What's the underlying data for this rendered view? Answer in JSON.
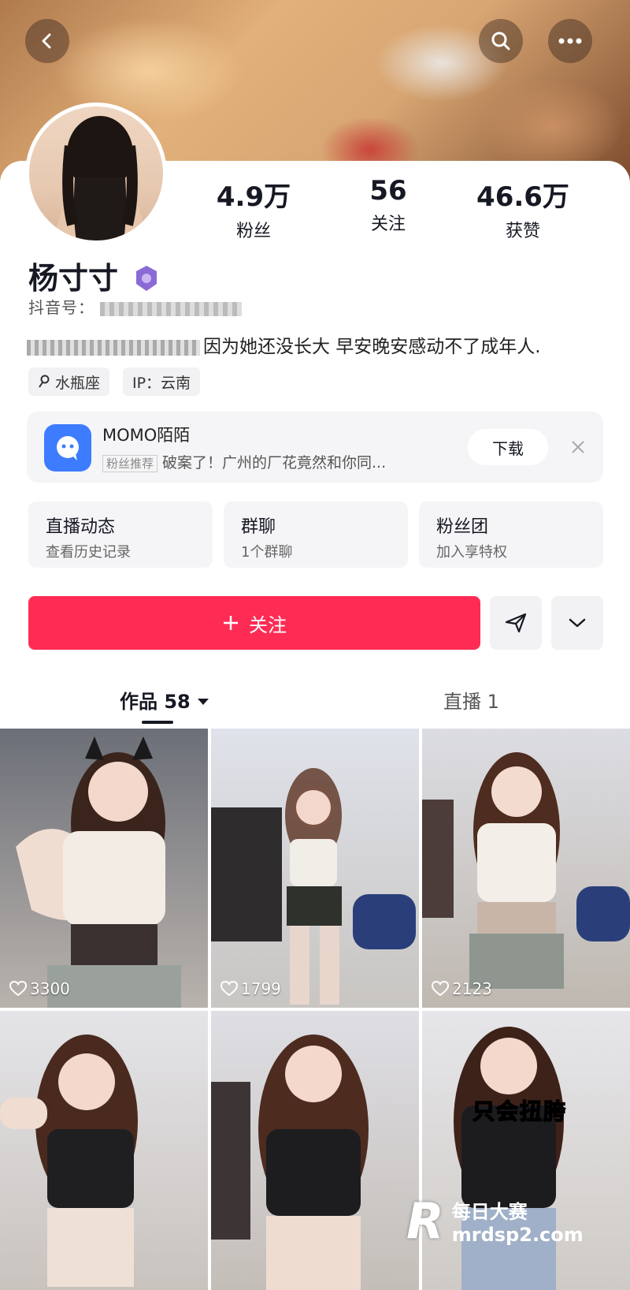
{
  "header": {
    "back": "back-icon",
    "search": "search-icon",
    "more": "more-icon"
  },
  "stats": [
    {
      "value": "4.9万",
      "label": "粉丝"
    },
    {
      "value": "56",
      "label": "关注"
    },
    {
      "value": "46.6万",
      "label": "获赞"
    }
  ],
  "profile": {
    "name": "杨寸寸",
    "uid": "抖音号：",
    "bio": "因为她还没长大 早安晚安感动不了成年人.",
    "tags": [
      "水瓶座",
      "IP：云南"
    ]
  },
  "ad": {
    "title": "MOMO陌陌",
    "badge": "粉丝推荐",
    "subtitle": "破案了！广州的厂花竟然和你同...",
    "button": "下载"
  },
  "features": [
    {
      "title": "直播动态",
      "subtitle": "查看历史记录"
    },
    {
      "title": "群聊",
      "subtitle": "1个群聊"
    },
    {
      "title": "粉丝团",
      "subtitle": "加入享特权"
    }
  ],
  "actions": {
    "follow": "关注"
  },
  "tabs": [
    {
      "label": "作品 58"
    },
    {
      "label": "直播 1"
    }
  ],
  "videos": [
    {
      "likes": "3300"
    },
    {
      "likes": "1799"
    },
    {
      "likes": "2123"
    },
    {
      "likes": ""
    },
    {
      "likes": ""
    },
    {
      "likes": "",
      "caption": "只会扭胯"
    }
  ],
  "watermark": {
    "line1": "每日大赛",
    "line2": "mrdsp2.com"
  },
  "colors": {
    "accent": "#fe2c55",
    "text": "#161823",
    "muted": "#666666"
  }
}
